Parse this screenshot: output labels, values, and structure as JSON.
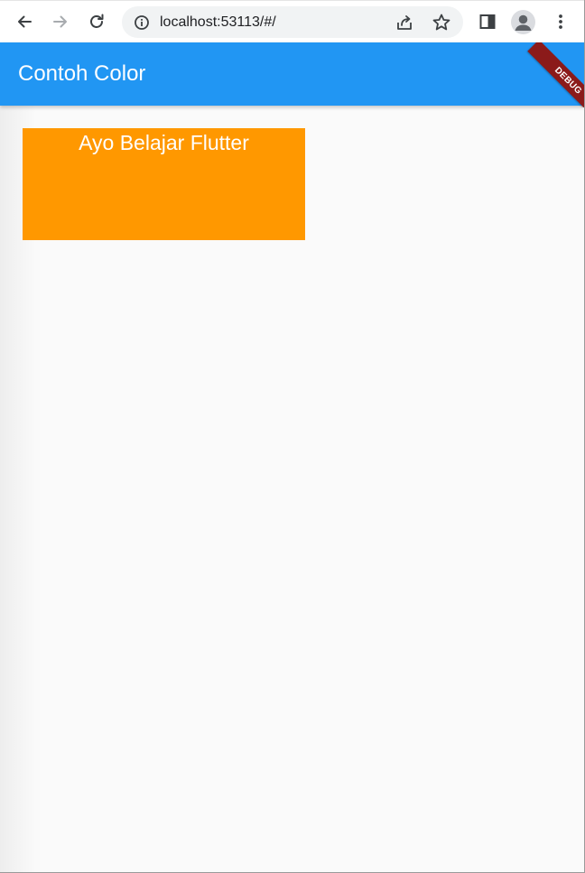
{
  "browser": {
    "url": "localhost:53113/#/"
  },
  "app_bar": {
    "title": "Contoh Color",
    "debug_label": "DEBUG",
    "color": "#2196f3"
  },
  "content": {
    "box_text": "Ayo Belajar Flutter",
    "box_color": "#ff9800"
  },
  "icons": {
    "back": "arrow-left-icon",
    "forward": "arrow-right-icon",
    "reload": "reload-icon",
    "info": "info-icon",
    "share": "share-icon",
    "bookmark": "star-icon",
    "side_panel": "side-panel-icon",
    "profile": "avatar-icon",
    "menu": "kebab-menu-icon"
  }
}
